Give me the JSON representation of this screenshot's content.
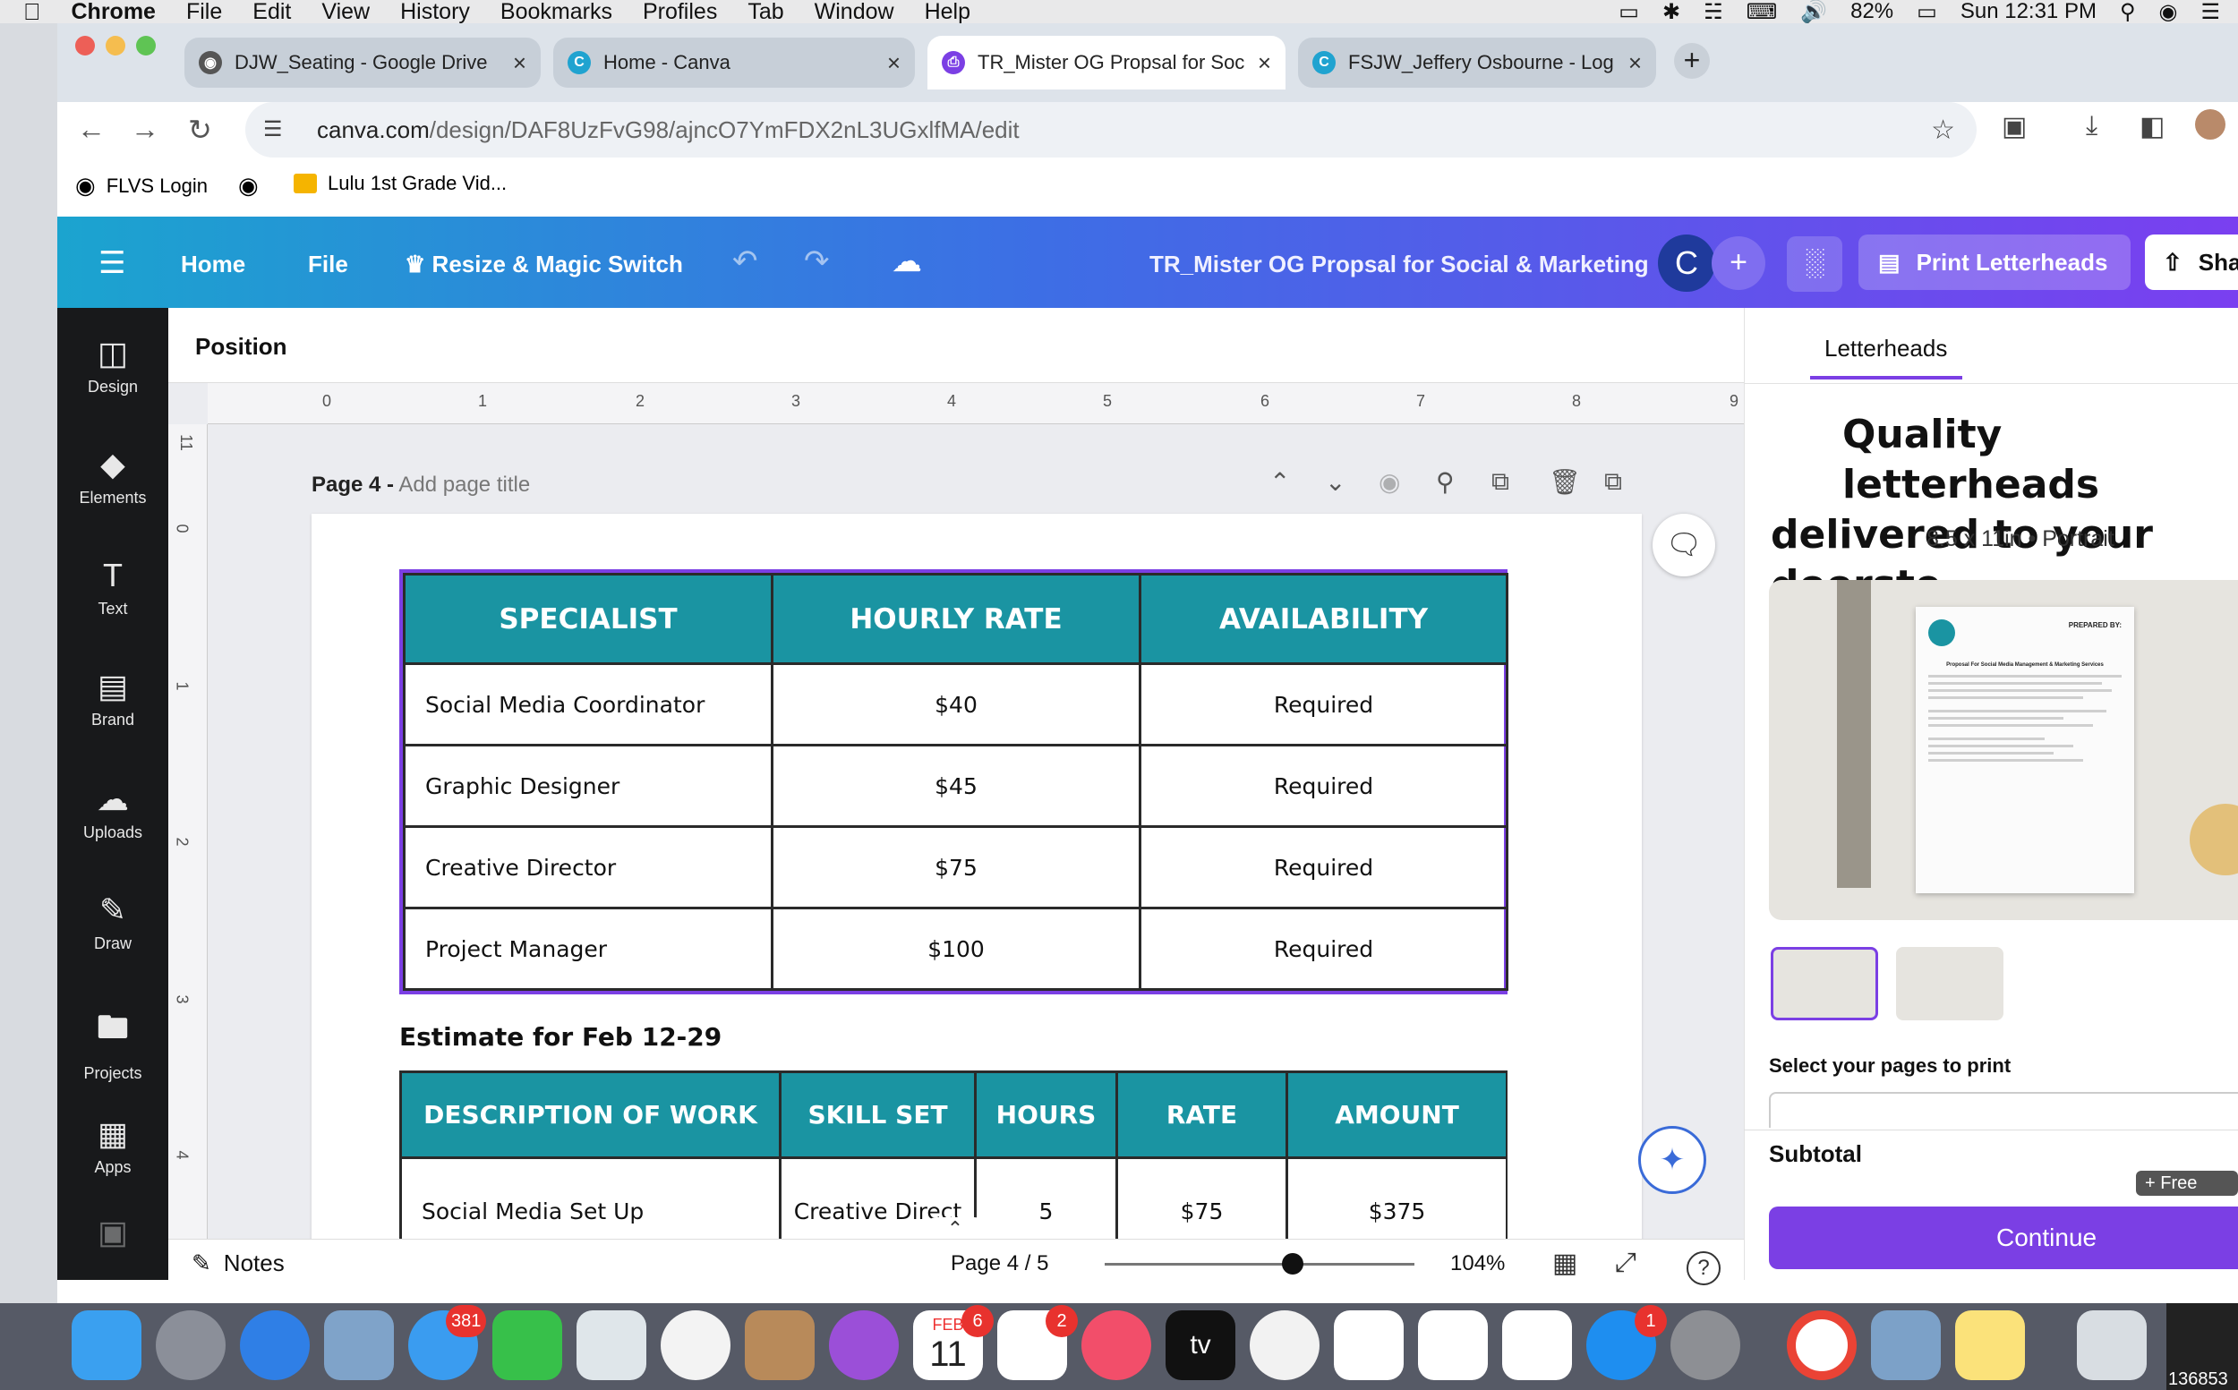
{
  "menubar": {
    "app": "Chrome",
    "items": [
      "File",
      "Edit",
      "View",
      "History",
      "Bookmarks",
      "Profiles",
      "Tab",
      "Window",
      "Help"
    ],
    "battery": "82%",
    "clock": "Sun 12:31 PM"
  },
  "tabs": [
    {
      "title": "DJW_Seating - Google Drive",
      "active": false
    },
    {
      "title": "Home - Canva",
      "active": false
    },
    {
      "title": "TR_Mister OG Propsal for Soc",
      "active": true
    },
    {
      "title": "FSJW_Jeffery Osbourne - Log",
      "active": false
    }
  ],
  "address": {
    "host": "canva.com",
    "path": "/design/DAF8UzFvG98/ajncO7YmFDX2nL3UGxlfMA/edit"
  },
  "bookmarks": [
    "FLVS Login",
    "Lulu 1st Grade Vid..."
  ],
  "canva_header": {
    "home": "Home",
    "file": "File",
    "resize": "Resize & Magic Switch",
    "doc_title": "TR_Mister OG Propsal for Social & Marketing",
    "avatar_letter": "C",
    "print_label": "Print Letterheads",
    "share_label": "Sha"
  },
  "rail": [
    "Design",
    "Elements",
    "Text",
    "Brand",
    "Uploads",
    "Draw",
    "Projects",
    "Apps"
  ],
  "editor": {
    "position_label": "Position",
    "ruler_h": [
      "0",
      "1",
      "2",
      "3",
      "4",
      "5",
      "6",
      "7",
      "8",
      "9"
    ],
    "ruler_v": [
      "11",
      "0",
      "1",
      "2",
      "3",
      "4"
    ],
    "page_label": "Page 4 -",
    "page_title_placeholder": "Add page title"
  },
  "table1": {
    "headers": [
      "SPECIALIST",
      "HOURLY RATE",
      "AVAILABILITY"
    ],
    "rows": [
      [
        "Social Media Coordinator",
        "$40",
        "Required"
      ],
      [
        "Graphic Designer",
        "$45",
        "Required"
      ],
      [
        "Creative Director",
        "$75",
        "Required"
      ],
      [
        "Project Manager",
        "$100",
        "Required"
      ]
    ]
  },
  "estimate_heading": "Estimate for Feb 12-29",
  "table2": {
    "headers": [
      "DESCRIPTION OF WORK",
      "SKILL SET",
      "HOURS",
      "RATE",
      "AMOUNT"
    ],
    "rows": [
      [
        "Social Media Set Up",
        "Creative Direct",
        "5",
        "$75",
        "$375"
      ]
    ]
  },
  "bottombar": {
    "notes": "Notes",
    "page_count": "Page 4 / 5",
    "zoom": "104%"
  },
  "right_panel": {
    "tab": "Letterheads",
    "headline_line1": "Quality letterheads",
    "headline_line2": "delivered to your doorste",
    "subhead": "8.5 x 11in • Portrait",
    "select_pages": "Select your pages to print",
    "subtotal": "Subtotal",
    "free_delivery": "+ Free deliv",
    "continue": "Continue",
    "preview_doc": {
      "prepared_by": "PREPARED BY:",
      "heading": "Proposal For Social Media Management & Marketing Services"
    }
  },
  "dock": {
    "badges": {
      "messages": "381",
      "calendar": "6",
      "reminders": "2",
      "appstore": "1"
    },
    "calendar_month": "FEB",
    "calendar_day": "11",
    "appletv": "tv",
    "corner_text": "136853"
  },
  "colors": {
    "teal": "#1a94a2",
    "purple": "#7b3fe4",
    "canva_grad_start": "#1ba4cf",
    "canva_grad_end": "#7a3ff0"
  }
}
